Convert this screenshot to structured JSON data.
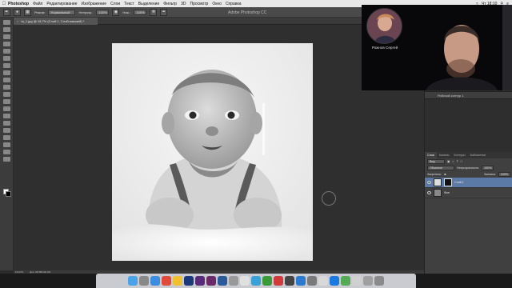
{
  "menubar": {
    "app_name": "Photoshop",
    "items": [
      "Файл",
      "Редактирование",
      "Изображение",
      "Слои",
      "Текст",
      "Выделение",
      "Фильтр",
      "3D",
      "Просмотр",
      "Окно",
      "Справка"
    ],
    "time": "Чт 18:10"
  },
  "options_bar": {
    "mode_label": "Режим:",
    "mode_value": "Нормальный",
    "opacity_label": "Непрозр.:",
    "opacity_value": "100%",
    "flow_label": "Наж.:",
    "flow_value": "100%",
    "window_title": "Adobe Photoshop CC"
  },
  "document": {
    "tab_label": "Ia_1.jpg @ 16,7% (Слой 1, Слой-маска/8) *",
    "status_zoom": "16,67%",
    "status_doc": "Док: 28,5М/100,2М"
  },
  "panels": {
    "paths_item": "Рабочий контур 1",
    "layer_tabs": [
      "Слои",
      "Каналы",
      "Контуры",
      "Библиотеки"
    ],
    "kind_label": "Вид",
    "blend_value": "Обычные",
    "opacity_label": "Непрозрачность:",
    "opacity_value": "100%",
    "lock_label": "Закрепить:",
    "fill_label": "Заливка:",
    "fill_value": "100%",
    "layers": [
      {
        "name": "Слой 1",
        "selected": true
      },
      {
        "name": "Фон",
        "selected": false
      }
    ]
  },
  "webcam": {
    "presenter_name": "Рожнов Сергей"
  },
  "colors": {
    "selection": "#5b7aa5",
    "panel_bg": "#3a3a3a",
    "canvas_bg": "#2f2f2f",
    "menubar_bg": "#e8e8e8"
  }
}
